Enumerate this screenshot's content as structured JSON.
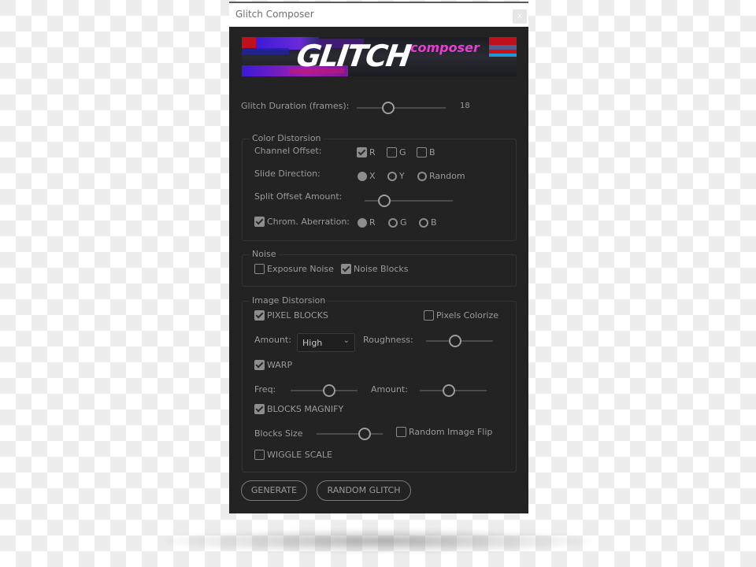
{
  "window": {
    "title": "Glitch Composer",
    "close_label": "x"
  },
  "banner": {
    "logo_text": "GLITCH",
    "logo_sub": "composer"
  },
  "glitch_duration": {
    "label": "Glitch Duration (frames):",
    "value": "18",
    "slider_fraction": 0.35
  },
  "color_distortion": {
    "title": "Color Distorsion",
    "channel_offset": {
      "label": "Channel Offset:",
      "options": [
        {
          "label": "R",
          "checked": true
        },
        {
          "label": "G",
          "checked": false
        },
        {
          "label": "B",
          "checked": false
        }
      ]
    },
    "slide_direction": {
      "label": "Slide Direction:",
      "options": [
        {
          "label": "X",
          "selected": true
        },
        {
          "label": "Y",
          "selected": false
        },
        {
          "label": "Random",
          "selected": false
        }
      ]
    },
    "split_offset": {
      "label": "Split Offset Amount:",
      "slider_fraction": 0.22
    },
    "chrom_aberration": {
      "label": "Chrom. Aberration:",
      "checked": true,
      "options": [
        {
          "label": "R",
          "selected": true
        },
        {
          "label": "G",
          "selected": false
        },
        {
          "label": "B",
          "selected": false
        }
      ]
    }
  },
  "noise": {
    "title": "Noise",
    "exposure_noise": {
      "label": "Exposure Noise",
      "checked": false
    },
    "noise_blocks": {
      "label": "Noise Blocks",
      "checked": true
    }
  },
  "image_distortion": {
    "title": "Image Distorsion",
    "pixel_blocks": {
      "label": "PIXEL BLOCKS",
      "checked": true
    },
    "pixels_colorize": {
      "label": "Pixels Colorize",
      "checked": false
    },
    "amount": {
      "label": "Amount:",
      "value": "High",
      "chevron": "⌄"
    },
    "roughness": {
      "label": "Roughness:",
      "slider_fraction": 0.43
    },
    "warp": {
      "label": "WARP",
      "checked": true
    },
    "freq": {
      "label": "Freq:",
      "slider_fraction": 0.58
    },
    "warp_amount": {
      "label": "Amount:",
      "slider_fraction": 0.44
    },
    "blocks_magnify": {
      "label": "BLOCKS MAGNIFY",
      "checked": true
    },
    "blocks_size": {
      "label": "Blocks Size",
      "slider_fraction": 0.73
    },
    "random_image_flip": {
      "label": "Random Image Flip",
      "checked": false
    },
    "wiggle_scale": {
      "label": "WIGGLE SCALE",
      "checked": false
    }
  },
  "buttons": {
    "generate": "GENERATE",
    "random_glitch": "RANDOM GLITCH"
  }
}
